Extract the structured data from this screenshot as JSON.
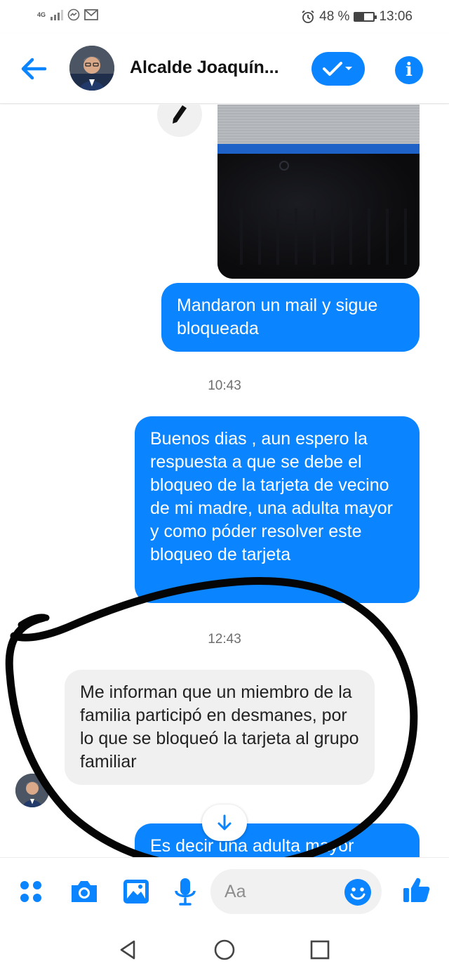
{
  "status_bar": {
    "network": "4G",
    "alarm_icon": "alarm-clock-icon",
    "battery_percent": "48 %",
    "battery_level": 0.48,
    "time": "13:06"
  },
  "header": {
    "contact_name": "Alcalde Joaquín...",
    "back_icon": "arrow-left-icon",
    "status_icon": "checkmark-dropdown-icon",
    "info_icon": "info-icon"
  },
  "messages": [
    {
      "type": "image",
      "from": "me",
      "content": "photo of laptop"
    },
    {
      "type": "text",
      "from": "me",
      "text": "Mandaron un mail y sigue bloqueada"
    },
    {
      "type": "timestamp",
      "text": "10:43"
    },
    {
      "type": "text",
      "from": "me",
      "text": "Buenos dias , aun espero la respuesta a que se debe el bloqueo de la tarjeta de vecino de mi madre, una adulta mayor y como póder resolver este bloqueo de tarjeta"
    },
    {
      "type": "timestamp",
      "text": "12:43"
    },
    {
      "type": "text",
      "from": "them",
      "text": "Me informan que un miembro de la familia participó en desmanes, por lo que se bloqueó la tarjeta al grupo familiar"
    },
    {
      "type": "text",
      "from": "me",
      "text": "Es decir una adulta mayor"
    }
  ],
  "composer": {
    "placeholder": "Aa",
    "icons": [
      "apps-grid-icon",
      "camera-icon",
      "gallery-icon",
      "microphone-icon",
      "emoji-icon",
      "thumbs-up-icon"
    ]
  },
  "colors": {
    "accent": "#0a84ff",
    "incoming_bubble": "#f1f0f0",
    "annotation_ink": "#050505"
  }
}
